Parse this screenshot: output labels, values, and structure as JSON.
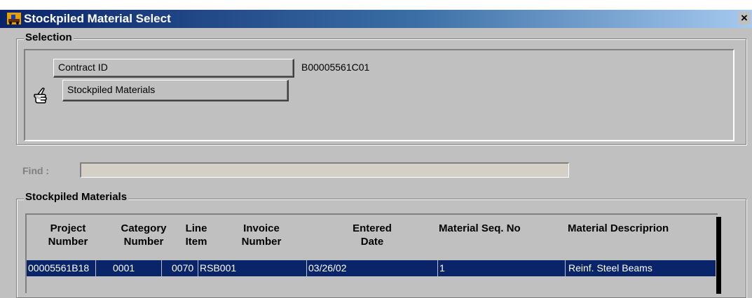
{
  "window": {
    "title": "Stockpiled Material Select",
    "close_label": "×"
  },
  "selection": {
    "legend": "Selection",
    "contract_id_button": "Contract ID",
    "contract_id_value": "B00005561C01",
    "stockpiled_materials_button": "Stockpiled Materials"
  },
  "find": {
    "label": "Find :",
    "value": ""
  },
  "materials": {
    "legend": "Stockpiled Materials",
    "columns": [
      {
        "line1": "Project",
        "line2": "Number"
      },
      {
        "line1": "Category",
        "line2": "Number"
      },
      {
        "line1": "Line",
        "line2": "Item"
      },
      {
        "line1": "Invoice",
        "line2": "Number"
      },
      {
        "line1": "Entered",
        "line2": "Date"
      },
      {
        "line1": "Material Seq. No",
        "line2": ""
      },
      {
        "line1": "Material Descriprion",
        "line2": ""
      }
    ],
    "rows": [
      {
        "project_number": "00005561B18",
        "category_number": "0001",
        "line_item": "0070",
        "invoice_number": "RSB001",
        "entered_date": "03/26/02",
        "material_seq_no": "1",
        "material_description": "Reinf. Steel Beams"
      }
    ]
  }
}
